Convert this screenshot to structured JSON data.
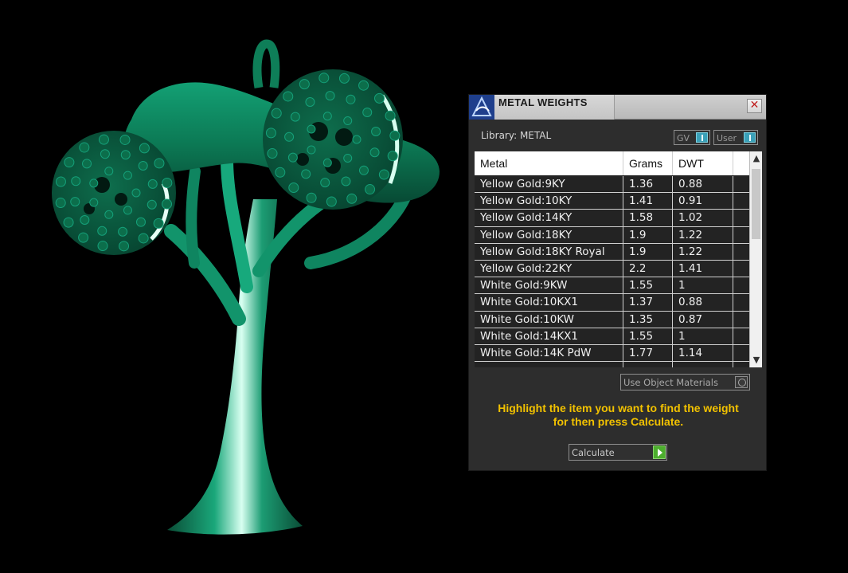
{
  "panel": {
    "title": "METAL WEIGHTS",
    "close_glyph": "✕",
    "library_label": "Library: METAL",
    "toggles": {
      "gv": "GV",
      "user": "User"
    }
  },
  "table": {
    "columns": [
      "Metal",
      "Grams",
      "DWT"
    ],
    "rows": [
      [
        "Yellow Gold:9KY",
        "1.36",
        "0.88"
      ],
      [
        "Yellow Gold:10KY",
        "1.41",
        "0.91"
      ],
      [
        "Yellow Gold:14KY",
        "1.58",
        "1.02"
      ],
      [
        "Yellow Gold:18KY",
        "1.9",
        "1.22"
      ],
      [
        "Yellow Gold:18KY Royal",
        "1.9",
        "1.22"
      ],
      [
        "Yellow Gold:22KY",
        "2.2",
        "1.41"
      ],
      [
        "White Gold:9KW",
        "1.55",
        "1"
      ],
      [
        "White Gold:10KX1",
        "1.37",
        "0.88"
      ],
      [
        "White Gold:10KW",
        "1.35",
        "0.87"
      ],
      [
        "White Gold:14KX1",
        "1.55",
        "1"
      ],
      [
        "White Gold:14K PdW",
        "1.77",
        "1.14"
      ]
    ]
  },
  "controls": {
    "use_object_materials": "Use Object Materials",
    "instruction_line1": "Highlight the item you want to find the weight",
    "instruction_line2": "for then press Calculate.",
    "calculate_label": "Calculate"
  },
  "colors": {
    "model_green": "#0c7a55",
    "instruction_yellow": "#f2c200",
    "panel_bg": "#2d2d2d"
  }
}
